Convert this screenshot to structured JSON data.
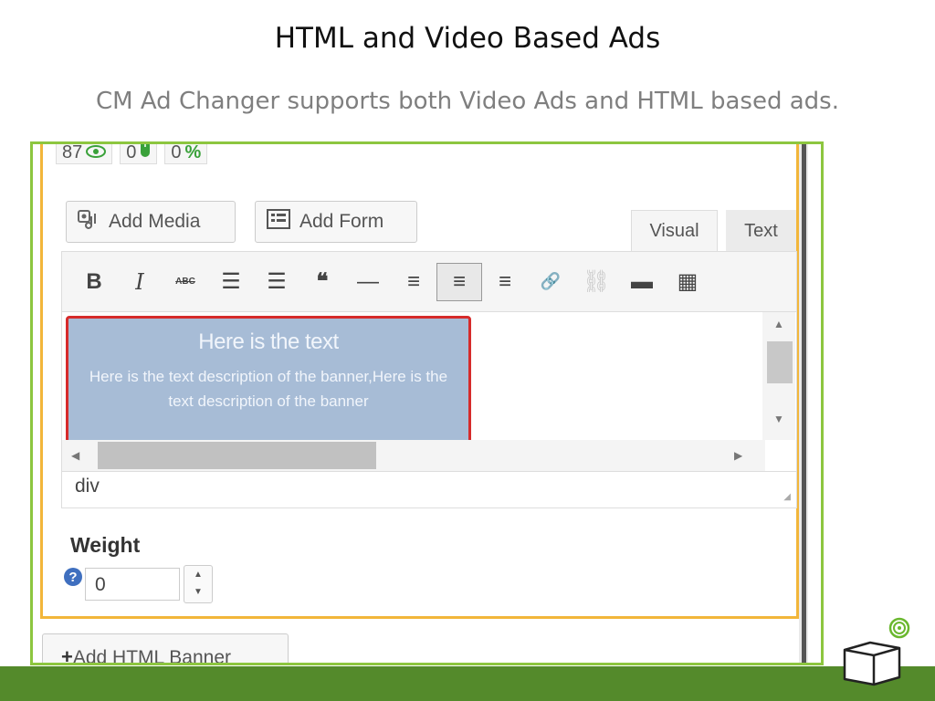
{
  "slide": {
    "title": "HTML and Video Based Ads",
    "subtitle": "CM Ad Changer supports both Video Ads and HTML based ads."
  },
  "stats": [
    {
      "value": "87",
      "icon": "eye-icon"
    },
    {
      "value": "0",
      "icon": "mouse-icon"
    },
    {
      "value": "0",
      "icon": "percent-icon",
      "symbol": "%"
    }
  ],
  "media_buttons": {
    "add_media": "Add Media",
    "add_form": "Add Form"
  },
  "editor_tabs": {
    "visual": "Visual",
    "text": "Text",
    "active": "Visual"
  },
  "toolbar": {
    "bold": "B",
    "italic": "I",
    "strike": "ABC",
    "bullets": "☰",
    "numbered": "☰",
    "quote": "❝",
    "hr": "—",
    "align_left": "≡",
    "align_center": "≡",
    "align_right": "≡",
    "link": "🔗",
    "unlink": "⛓",
    "more": "▬",
    "kitchen_sink": "▦",
    "active_button": "align-center"
  },
  "banner": {
    "title": "Here is the text",
    "description": "Here is the text description of the banner,Here is the text description of the banner"
  },
  "editor_path": "div",
  "weight": {
    "label": "Weight",
    "value": "0",
    "help": "?"
  },
  "add_html_banner": {
    "plus": "+",
    "label": "Add HTML Banner"
  },
  "colors": {
    "accent_green": "#548a2b",
    "frame_green": "#8dc63f",
    "panel_orange": "#f2b63a",
    "banner_fill": "#a7bcd6",
    "banner_border": "#d62b2b"
  }
}
